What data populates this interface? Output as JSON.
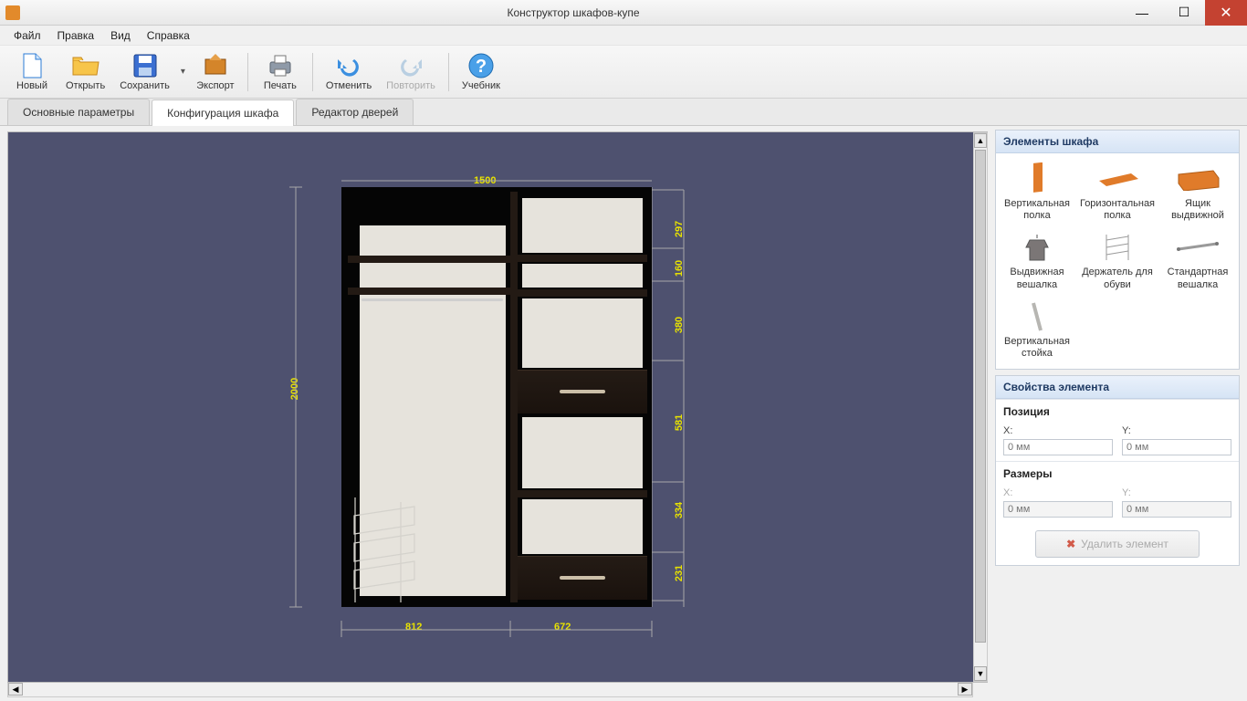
{
  "window": {
    "title": "Конструктор шкафов-купе"
  },
  "menu": {
    "file": "Файл",
    "edit": "Правка",
    "view": "Вид",
    "help": "Справка"
  },
  "toolbar": {
    "new": "Новый",
    "open": "Открыть",
    "save": "Сохранить",
    "export": "Экспорт",
    "print": "Печать",
    "undo": "Отменить",
    "redo": "Повторить",
    "tutorial": "Учебник"
  },
  "tabs": {
    "params": "Основные параметры",
    "config": "Конфигурация шкафа",
    "doors": "Редактор дверей"
  },
  "dimensions": {
    "height": "2000",
    "width_top": "1500",
    "right_segments": [
      "297",
      "160",
      "380",
      "581",
      "334",
      "231"
    ],
    "bottom_left": "812",
    "bottom_right": "672"
  },
  "sidebar": {
    "elements_title": "Элементы шкафа",
    "items": [
      {
        "label": "Вертикальная полка"
      },
      {
        "label": "Горизонтальная полка"
      },
      {
        "label": "Ящик выдвижной"
      },
      {
        "label": "Выдвижная вешалка"
      },
      {
        "label": "Держатель для обуви"
      },
      {
        "label": "Стандартная вешалка"
      },
      {
        "label": "Вертикальная стойка"
      }
    ],
    "props_title": "Свойства элемента",
    "position_title": "Позиция",
    "size_title": "Размеры",
    "x_label": "X:",
    "y_label": "Y:",
    "placeholder": "0 мм",
    "delete_label": "Удалить элемент"
  }
}
